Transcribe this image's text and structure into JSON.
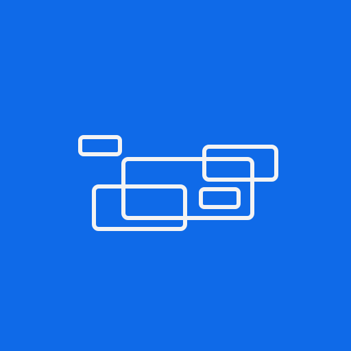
{
  "colors": {
    "background": "#0f6ae8",
    "shape_stroke": "#f3f3f3"
  },
  "icon": {
    "name": "overlapping-rectangles-icon"
  }
}
